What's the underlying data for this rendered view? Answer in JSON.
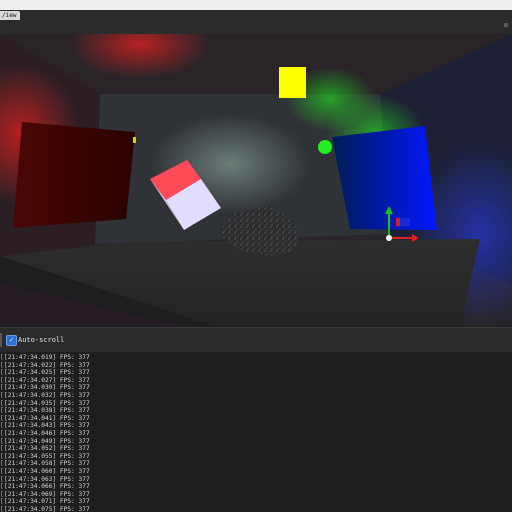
{
  "window": {
    "tab_label": "/iew"
  },
  "viewport": {
    "light_colors": [
      "#ff1f1f",
      "#1fdc1f",
      "#2a3fff",
      "#ffff00"
    ],
    "gizmo_axes": [
      "x",
      "y",
      "z"
    ]
  },
  "console": {
    "autoscroll_label": "Auto-scroll",
    "autoscroll_checked": true,
    "lines": [
      "[21:47:34.019] FPS: 377",
      "[21:47:34.022] FPS: 377",
      "[21:47:34.025] FPS: 377",
      "[21:47:34.027] FPS: 377",
      "[21:47:34.030] FPS: 377",
      "[21:47:34.032] FPS: 377",
      "[21:47:34.035] FPS: 377",
      "[21:47:34.038] FPS: 377",
      "[21:47:34.041] FPS: 377",
      "[21:47:34.043] FPS: 377",
      "[21:47:34.046] FPS: 377",
      "[21:47:34.049] FPS: 377",
      "[21:47:34.052] FPS: 377",
      "[21:47:34.055] FPS: 377",
      "[21:47:34.058] FPS: 377",
      "[21:47:34.060] FPS: 377",
      "[21:47:34.063] FPS: 377",
      "[21:47:34.066] FPS: 377",
      "[21:47:34.069] FPS: 377",
      "[21:47:34.071] FPS: 377",
      "[21:47:34.075] FPS: 377"
    ]
  }
}
